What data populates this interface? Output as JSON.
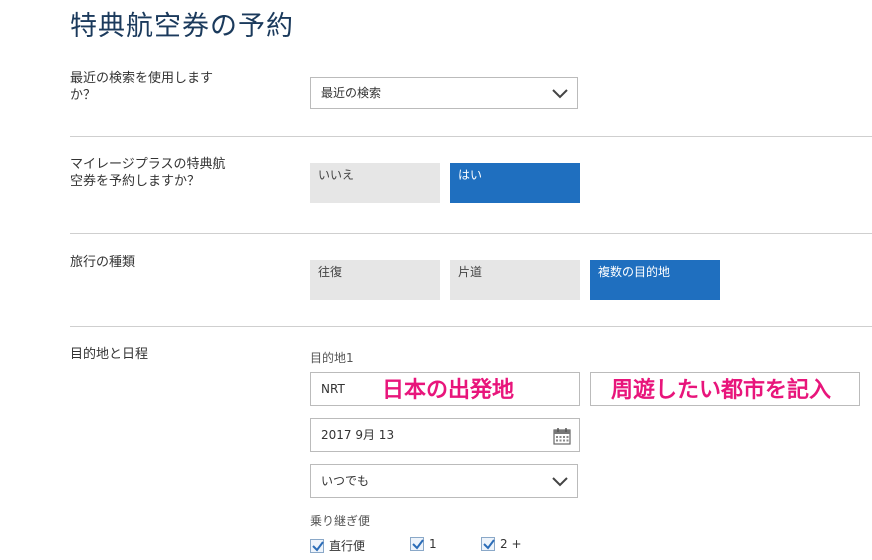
{
  "page": {
    "title": "特典航空券の予約"
  },
  "recent_search": {
    "label": "最近の検索を使用しますか？",
    "selected": "最近の検索"
  },
  "book_with_miles": {
    "label": "マイレージプラスの特典航空券を予約しますか？",
    "options": [
      "いいえ",
      "はい"
    ],
    "selected": "はい"
  },
  "trip_type": {
    "label": "旅行の種類",
    "options": [
      "往復",
      "片道",
      "複数の目的地"
    ],
    "selected": "複数の目的地"
  },
  "itinerary": {
    "label": "目的地と日程",
    "destination_label": "目的地1",
    "origin_value": "NRT",
    "origin_annotation": "日本の出発地",
    "destination_annotation": "周遊したい都市を記入",
    "date_value": "2017 9月 13",
    "flex_selected": "いつでも",
    "connections_label": "乗り継ぎ便",
    "connections": [
      {
        "label": "直行便",
        "checked": true
      },
      {
        "label": "1",
        "checked": true
      },
      {
        "label": "2 +",
        "checked": true
      }
    ]
  },
  "colors": {
    "accent": "#1f6fbf",
    "annotation": "#e8157b",
    "title": "#1b3a5c"
  }
}
